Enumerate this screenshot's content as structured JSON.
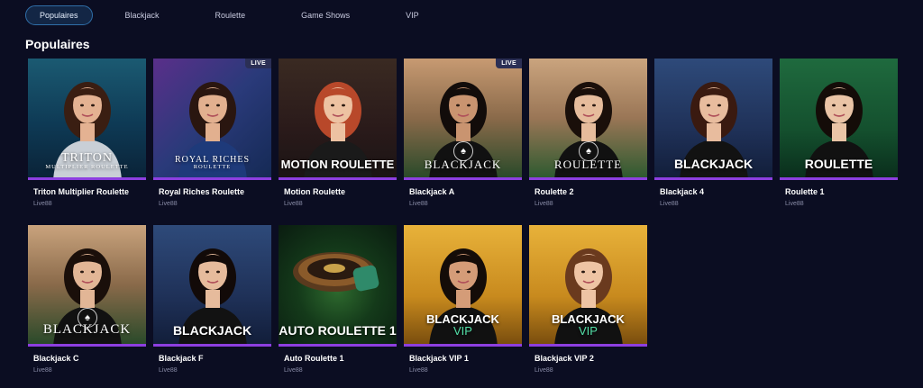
{
  "tabs": [
    {
      "label": "Populaires",
      "active": true
    },
    {
      "label": "Blackjack",
      "active": false
    },
    {
      "label": "Roulette",
      "active": false
    },
    {
      "label": "Game Shows",
      "active": false
    },
    {
      "label": "VIP",
      "active": false
    }
  ],
  "section": {
    "title": "Populaires"
  },
  "games": [
    {
      "name": "Triton Multiplier Roulette",
      "provider": "Live88",
      "art_title": "TRITON",
      "art_sub": "MULTIPLIER ROULETTE",
      "live": "",
      "theme": "triton"
    },
    {
      "name": "Royal Riches Roulette",
      "provider": "Live88",
      "art_title": "ROYAL RICHES",
      "art_sub": "ROULETTE",
      "live": "LIVE",
      "theme": "royal"
    },
    {
      "name": "Motion Roulette",
      "provider": "Live88",
      "art_title": "MOTION ROULETTE",
      "art_sub": "",
      "live": "",
      "theme": "motion"
    },
    {
      "name": "Blackjack A",
      "provider": "Live88",
      "art_title": "BLACKJACK",
      "art_sub": "",
      "live": "LIVE",
      "theme": "bjA"
    },
    {
      "name": "Roulette 2",
      "provider": "Live88",
      "art_title": "ROULETTE",
      "art_sub": "",
      "live": "",
      "theme": "r2"
    },
    {
      "name": "Blackjack 4",
      "provider": "Live88",
      "art_title": "BLACKJACK",
      "art_sub": "",
      "live": "",
      "theme": "bj4"
    },
    {
      "name": "Roulette 1",
      "provider": "Live88",
      "art_title": "ROULETTE",
      "art_sub": "",
      "live": "",
      "theme": "r1"
    },
    {
      "name": "Blackjack C",
      "provider": "Live88",
      "art_title": "BLACKJACK",
      "art_sub": "",
      "live": "",
      "theme": "bjC"
    },
    {
      "name": "Blackjack F",
      "provider": "Live88",
      "art_title": "BLACKJACK",
      "art_sub": "",
      "live": "",
      "theme": "bjF"
    },
    {
      "name": "Auto Roulette 1",
      "provider": "Live88",
      "art_title": "AUTO ROULETTE 1",
      "art_sub": "",
      "live": "",
      "theme": "auto"
    },
    {
      "name": "Blackjack VIP 1",
      "provider": "Live88",
      "art_title": "BLACKJACK",
      "art_sub": "VIP",
      "live": "",
      "theme": "vip1"
    },
    {
      "name": "Blackjack VIP 2",
      "provider": "Live88",
      "art_title": "BLACKJACK",
      "art_sub": "VIP",
      "live": "",
      "theme": "vip2"
    }
  ],
  "colors": {
    "page_bg": "#0b0d22",
    "tab_active_border": "#2f6ea8",
    "card_underline": "#8d3fe0",
    "provider_text": "#8a8da8",
    "vip_green": "#53e0a8"
  }
}
